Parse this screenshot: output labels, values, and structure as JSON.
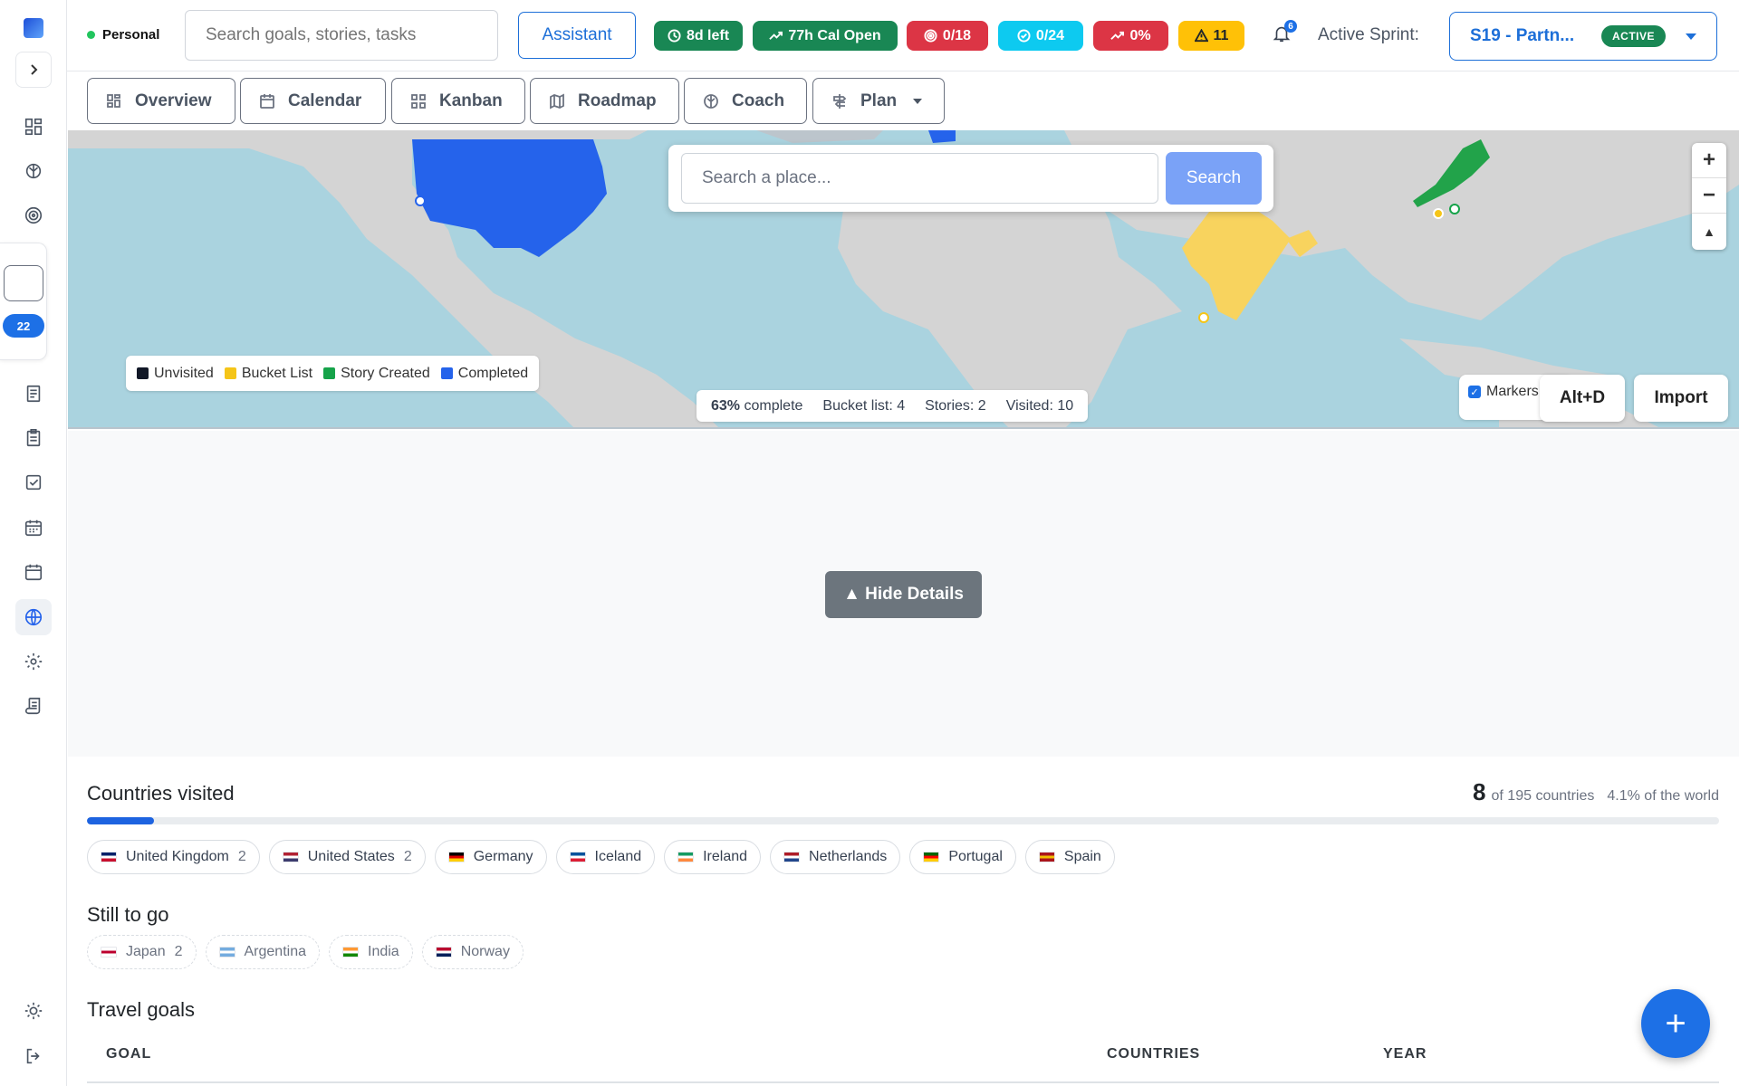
{
  "header": {
    "persona": "Personal",
    "search_placeholder": "Search goals, stories, tasks",
    "assistant_label": "Assistant",
    "pills": [
      {
        "label": "8d left",
        "icon": "clock-icon",
        "color": "#198754"
      },
      {
        "label": "77h Cal Open",
        "icon": "trend-up-icon",
        "color": "#198754"
      },
      {
        "label": "0/18",
        "icon": "target-icon",
        "color": "#dc3545"
      },
      {
        "label": "0/24",
        "icon": "check-circle-icon",
        "color": "#0dcaf0"
      },
      {
        "label": "0%",
        "icon": "trend-up-icon",
        "color": "#dc3545"
      },
      {
        "label": "11",
        "icon": "warning-icon",
        "color": "#ffc107"
      }
    ],
    "notifications_count": "6",
    "active_sprint_label": "Active Sprint:",
    "sprint_name": "S19 - Partn...",
    "sprint_status": "ACTIVE"
  },
  "sidebar": {
    "badge_count": "22"
  },
  "tabs": [
    {
      "label": "Overview",
      "icon": "grid-icon"
    },
    {
      "label": "Calendar",
      "icon": "calendar-icon"
    },
    {
      "label": "Kanban",
      "icon": "kanban-icon"
    },
    {
      "label": "Roadmap",
      "icon": "map-icon"
    },
    {
      "label": "Coach",
      "icon": "brain-icon"
    },
    {
      "label": "Plan",
      "icon": "signpost-icon"
    }
  ],
  "map": {
    "search_placeholder": "Search a place...",
    "search_button": "Search",
    "legend": [
      {
        "label": "Unvisited",
        "color": "#111827"
      },
      {
        "label": "Bucket List",
        "color": "#f5c518"
      },
      {
        "label": "Story Created",
        "color": "#16a34a"
      },
      {
        "label": "Completed",
        "color": "#2563eb"
      }
    ],
    "stats": {
      "percent": "63%",
      "complete_label": "complete",
      "bucket": "Bucket list: 4",
      "stories": "Stories: 2",
      "visited": "Visited: 10"
    },
    "markers_label": "Markers",
    "altd_label": "Alt+D",
    "import_label": "Import"
  },
  "details": {
    "hide_label": "▲ Hide Details"
  },
  "countries": {
    "title": "Countries visited",
    "count": "8",
    "of_label": "of 195 countries",
    "world_pct": "4.1% of the world",
    "progress_fraction": 0.041,
    "visited": [
      {
        "name": "United Kingdom",
        "count": "2",
        "flag": [
          "#012169",
          "#ffffff",
          "#c8102e"
        ]
      },
      {
        "name": "United States",
        "count": "2",
        "flag": [
          "#b22234",
          "#ffffff",
          "#3c3b6e"
        ]
      },
      {
        "name": "Germany",
        "count": "",
        "flag": [
          "#000000",
          "#dd0000",
          "#ffce00"
        ]
      },
      {
        "name": "Iceland",
        "count": "",
        "flag": [
          "#02529c",
          "#ffffff",
          "#dc1e35"
        ]
      },
      {
        "name": "Ireland",
        "count": "",
        "flag": [
          "#169b62",
          "#ffffff",
          "#ff883e"
        ]
      },
      {
        "name": "Netherlands",
        "count": "",
        "flag": [
          "#ae1c28",
          "#ffffff",
          "#21468b"
        ]
      },
      {
        "name": "Portugal",
        "count": "",
        "flag": [
          "#006600",
          "#ff0000",
          "#ffcc00"
        ]
      },
      {
        "name": "Spain",
        "count": "",
        "flag": [
          "#aa151b",
          "#f1bf00",
          "#aa151b"
        ]
      }
    ],
    "togo_title": "Still to go",
    "togo": [
      {
        "name": "Japan",
        "count": "2",
        "flag": [
          "#ffffff",
          "#bc002d",
          "#ffffff"
        ]
      },
      {
        "name": "Argentina",
        "count": "",
        "flag": [
          "#74acdf",
          "#ffffff",
          "#74acdf"
        ]
      },
      {
        "name": "India",
        "count": "",
        "flag": [
          "#ff9933",
          "#ffffff",
          "#138808"
        ]
      },
      {
        "name": "Norway",
        "count": "",
        "flag": [
          "#ba0c2f",
          "#ffffff",
          "#00205b"
        ]
      }
    ]
  },
  "goals": {
    "title": "Travel goals",
    "col_goal": "GOAL",
    "col_countries": "COUNTRIES",
    "col_year": "YEAR"
  }
}
